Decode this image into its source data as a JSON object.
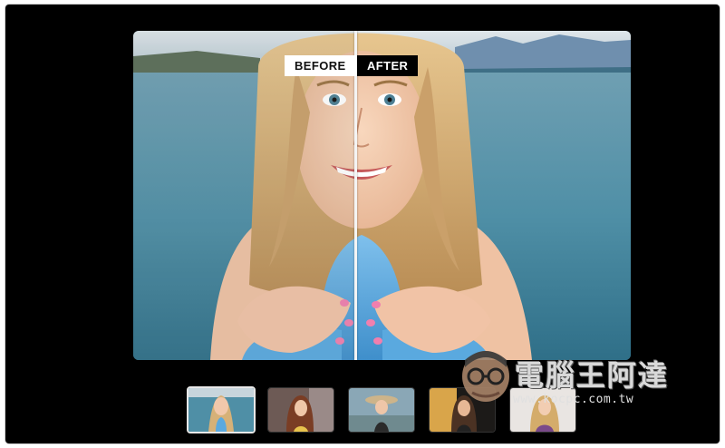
{
  "viewer": {
    "before_label": "BEFORE",
    "after_label": "AFTER",
    "divider_position": 0.45
  },
  "thumbnails": [
    {
      "name": "thumb-1",
      "selected": true
    },
    {
      "name": "thumb-2",
      "selected": false
    },
    {
      "name": "thumb-3",
      "selected": false
    },
    {
      "name": "thumb-4",
      "selected": false
    },
    {
      "name": "thumb-5",
      "selected": false
    }
  ],
  "watermark": {
    "title": "電腦王阿達",
    "url": "www.kocpc.com.tw"
  },
  "colors": {
    "frame": "#000000",
    "water": "#4f8fa6",
    "hair": "#d6b178",
    "skin": "#f1c8ab",
    "board": "#5aa9df"
  },
  "icons": {
    "watermark_mascot": "mascot-face-icon"
  }
}
